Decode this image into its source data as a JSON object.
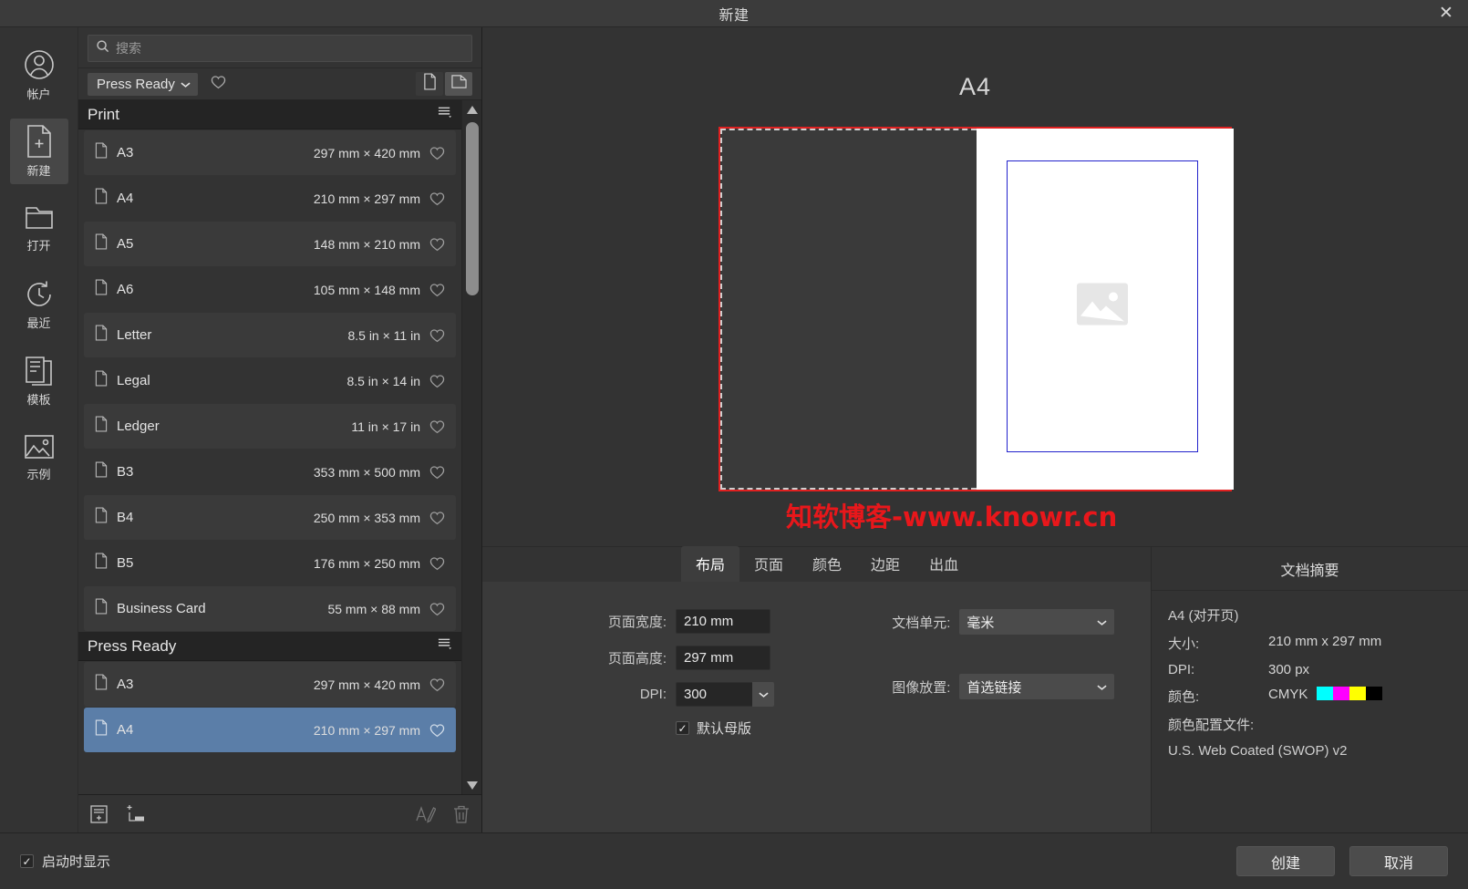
{
  "window": {
    "title": "新建",
    "close_label": "✕"
  },
  "rail": {
    "items": [
      {
        "label": "帐户",
        "icon": "account-icon",
        "active": false
      },
      {
        "label": "新建",
        "icon": "new-document-icon",
        "active": true
      },
      {
        "label": "打开",
        "icon": "open-folder-icon",
        "active": false
      },
      {
        "label": "最近",
        "icon": "recent-clock-icon",
        "active": false
      },
      {
        "label": "模板",
        "icon": "templates-icon",
        "active": false
      },
      {
        "label": "示例",
        "icon": "samples-image-icon",
        "active": false
      }
    ]
  },
  "presets": {
    "search": {
      "placeholder": "搜索",
      "value": "",
      "icon": "search-icon"
    },
    "filter": {
      "label": "Press Ready",
      "chevron": "chevron-down-icon",
      "favorite_icon": "heart-icon"
    },
    "view_modes": [
      {
        "name": "single-page-view",
        "icon": "page-icon",
        "active": false
      },
      {
        "name": "facing-pages-view",
        "icon": "spread-icon",
        "active": true
      }
    ],
    "groups": [
      {
        "title": "Print",
        "menu_icon": "list-menu-icon",
        "rows": [
          {
            "name": "A3",
            "dim": "297 mm × 420 mm",
            "selected": false
          },
          {
            "name": "A4",
            "dim": "210 mm × 297 mm",
            "selected": false
          },
          {
            "name": "A5",
            "dim": "148 mm × 210 mm",
            "selected": false
          },
          {
            "name": "A6",
            "dim": "105 mm × 148 mm",
            "selected": false
          },
          {
            "name": "Letter",
            "dim": "8.5 in × 11 in",
            "selected": false
          },
          {
            "name": "Legal",
            "dim": "8.5 in × 14 in",
            "selected": false
          },
          {
            "name": "Ledger",
            "dim": "11 in × 17 in",
            "selected": false
          },
          {
            "name": "B3",
            "dim": "353 mm × 500 mm",
            "selected": false
          },
          {
            "name": "B4",
            "dim": "250 mm × 353 mm",
            "selected": false
          },
          {
            "name": "B5",
            "dim": "176 mm × 250 mm",
            "selected": false
          },
          {
            "name": "Business Card",
            "dim": "55 mm × 88 mm",
            "selected": false
          }
        ]
      },
      {
        "title": "Press Ready",
        "menu_icon": "list-menu-icon",
        "rows": [
          {
            "name": "A3",
            "dim": "297 mm × 420 mm",
            "selected": false
          },
          {
            "name": "A4",
            "dim": "210 mm × 297 mm",
            "selected": true
          }
        ]
      }
    ],
    "toolbar": [
      {
        "name": "new-preset-button",
        "icon": "new-preset-icon",
        "dim": false
      },
      {
        "name": "new-category-button",
        "icon": "add-category-icon",
        "dim": false
      },
      {
        "name": "rename-preset-button",
        "icon": "rename-icon",
        "dim": true
      },
      {
        "name": "delete-preset-button",
        "icon": "trash-icon",
        "dim": true
      }
    ]
  },
  "preview": {
    "title": "A4",
    "watermark": "知软博客-www.knowr.cn",
    "placeholder_icon": "image-placeholder-icon",
    "colors": {
      "bleed": "#e02020",
      "margin": "#2222cc",
      "page": "#ffffff",
      "watermark": "#e8171b"
    }
  },
  "settings": {
    "tabs": [
      {
        "label": "布局",
        "active": true
      },
      {
        "label": "页面",
        "active": false
      },
      {
        "label": "颜色",
        "active": false
      },
      {
        "label": "边距",
        "active": false
      },
      {
        "label": "出血",
        "active": false
      }
    ],
    "fields": {
      "page_width": {
        "label": "页面宽度:",
        "value": "210 mm"
      },
      "page_height": {
        "label": "页面高度:",
        "value": "297 mm"
      },
      "dpi": {
        "label": "DPI:",
        "value": "300"
      },
      "master_page": {
        "label": "默认母版",
        "checked": true,
        "tick": "✓"
      },
      "doc_units": {
        "label": "文档单元:",
        "value": "毫米"
      },
      "image_placement": {
        "label": "图像放置:",
        "value": "首选链接"
      }
    }
  },
  "summary": {
    "heading": "文档摘要",
    "doc_name": "A4 (对开页)",
    "lines": [
      {
        "key": "大小:",
        "value": "210 mm  x  297 mm"
      },
      {
        "key": "DPI:",
        "value": "300 px"
      }
    ],
    "color": {
      "key": "颜色:",
      "value": "CMYK",
      "swatches": [
        "#00ffff",
        "#ff00ff",
        "#ffff00",
        "#000000"
      ]
    },
    "profile_key": "颜色配置文件:",
    "profile_value": "U.S. Web Coated (SWOP) v2"
  },
  "bottom": {
    "show_on_startup": {
      "label": "启动时显示",
      "checked": true,
      "tick": "✓"
    },
    "create": "创建",
    "cancel": "取消"
  }
}
